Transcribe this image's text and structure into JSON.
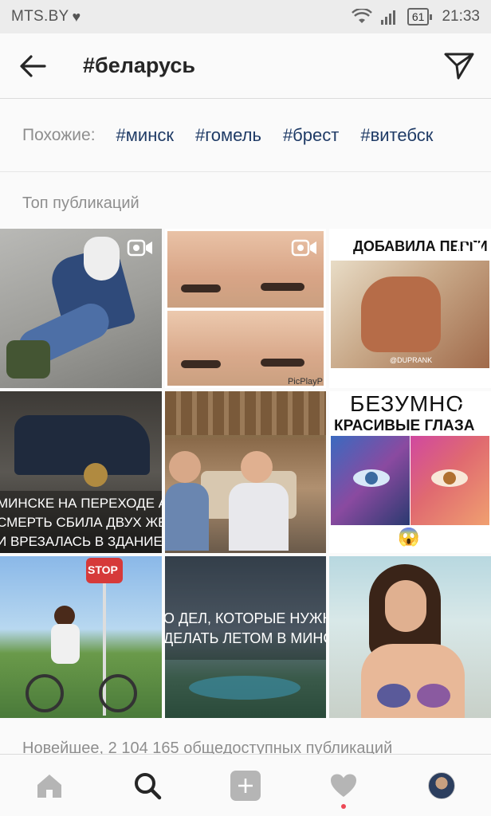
{
  "status_bar": {
    "carrier": "MTS.BY",
    "battery": "61",
    "time": "21:33"
  },
  "header": {
    "title": "#беларусь",
    "back_icon": "arrow-left-icon",
    "send_icon": "paper-plane-icon"
  },
  "related": {
    "label": "Похожие:",
    "tags": [
      "#минск",
      "#гомель",
      "#брест",
      "#витебск"
    ]
  },
  "top_posts": {
    "title": "Топ публикаций",
    "posts": [
      {
        "kind": "photo",
        "video": true
      },
      {
        "kind": "photo",
        "video": true,
        "watermark": "PicPlayP"
      },
      {
        "kind": "photo",
        "video": true,
        "caption": "ДОБАВИЛА ПЕРГИ",
        "sub": "@DUPRANK"
      },
      {
        "kind": "photo",
        "video": false,
        "caption_lines": [
          "МИНСКЕ НА ПЕРЕХОДЕ AU",
          "СМЕРТЬ СБИЛА ДВУХ ЖЕН",
          "И ВРЕЗАЛАСЬ В ЗДАНИЕ"
        ]
      },
      {
        "kind": "photo",
        "video": false
      },
      {
        "kind": "photo",
        "video": true,
        "caption_lines": [
          "БЕЗУМНО",
          "КРАСИВЫЕ ГЛАЗА"
        ],
        "emoji": "😱"
      },
      {
        "kind": "photo",
        "video": false,
        "sign": "STOP"
      },
      {
        "kind": "photo",
        "video": false,
        "caption_lines": [
          "О ДЕЛ, КОТОРЫЕ НУЖН",
          "ДЕЛАТЬ ЛЕТОМ В МИНС"
        ]
      },
      {
        "kind": "photo",
        "video": false
      }
    ]
  },
  "newest": {
    "text": "Новейшее, 2 104 165 общедоступных публикаций"
  },
  "bottom_nav": {
    "items": [
      "home-icon",
      "search-icon",
      "add-icon",
      "heart-icon",
      "profile-avatar"
    ]
  },
  "colors": {
    "tag_link": "#1f3b66",
    "muted": "#8e8e8e",
    "notification": "#ed4956"
  }
}
